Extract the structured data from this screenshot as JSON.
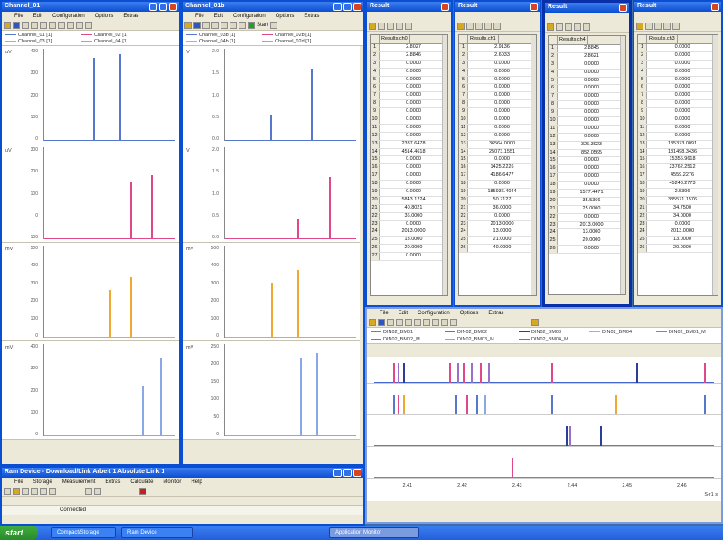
{
  "left_window": {
    "title": "Channel_01",
    "menus": [
      "File",
      "Edit",
      "Configuration",
      "Options",
      "Extras"
    ],
    "legend": [
      "Channel_01 [1]",
      "Channel_02 [1]",
      "Channel_03 [1]",
      "Channel_04 [1]"
    ],
    "plots": [
      {
        "unit": "uV",
        "color": "#5577cc",
        "yticks": [
          "400",
          "300",
          "200",
          "100",
          "0"
        ],
        "peaks": [
          {
            "x": 0.38,
            "h": 0.9
          },
          {
            "x": 0.58,
            "h": 0.94
          }
        ]
      },
      {
        "unit": "uV",
        "color": "#e0488a",
        "yticks": [
          "300",
          "200",
          "100",
          "0",
          "-100"
        ],
        "peaks": [
          {
            "x": 0.66,
            "h": 0.62
          },
          {
            "x": 0.82,
            "h": 0.7
          }
        ]
      },
      {
        "unit": "mV",
        "color": "#f0a830",
        "yticks": [
          "500",
          "400",
          "300",
          "200",
          "100",
          "0"
        ],
        "peaks": [
          {
            "x": 0.5,
            "h": 0.52
          },
          {
            "x": 0.66,
            "h": 0.66
          }
        ]
      },
      {
        "unit": "mV",
        "color": "#8aa8e8",
        "yticks": [
          "400",
          "300",
          "200",
          "100",
          "0"
        ],
        "peaks": [
          {
            "x": 0.75,
            "h": 0.55
          },
          {
            "x": 0.89,
            "h": 0.85
          }
        ]
      }
    ]
  },
  "mid_window": {
    "title": "Channel_01b",
    "menus": [
      "File",
      "Edit",
      "Configuration",
      "Options",
      "Extras"
    ],
    "legend": [
      "Channel_03b [1]",
      "Channel_02b [1]",
      "Channel_04b [1]",
      "Channel_02d [1]"
    ],
    "toolbar_label": "Start",
    "plots": [
      {
        "unit": "V",
        "color": "#5577cc",
        "yticks": [
          "2.0",
          "1.5",
          "1.0",
          "0.5",
          "0.0"
        ],
        "peaks": [
          {
            "x": 0.35,
            "h": 0.28
          },
          {
            "x": 0.66,
            "h": 0.78
          }
        ]
      },
      {
        "unit": "V",
        "color": "#e0488a",
        "yticks": [
          "2.0",
          "1.5",
          "1.0",
          "0.5",
          "0.0"
        ],
        "peaks": [
          {
            "x": 0.56,
            "h": 0.22
          },
          {
            "x": 0.8,
            "h": 0.68
          }
        ]
      },
      {
        "unit": "mV",
        "color": "#f0a830",
        "yticks": [
          "500",
          "400",
          "300",
          "200",
          "100",
          "0"
        ],
        "peaks": [
          {
            "x": 0.36,
            "h": 0.6
          },
          {
            "x": 0.56,
            "h": 0.74
          }
        ]
      },
      {
        "unit": "mV",
        "color": "#8aa8e8",
        "yticks": [
          "250",
          "200",
          "150",
          "100",
          "50",
          "0"
        ],
        "peaks": [
          {
            "x": 0.58,
            "h": 0.84
          },
          {
            "x": 0.7,
            "h": 0.9
          }
        ]
      }
    ]
  },
  "grids": [
    {
      "title": "Result",
      "header": "Results.ch0",
      "rows": [
        "2.8027",
        "2.8846",
        "0.0000",
        "0.0000",
        "0.0000",
        "0.0000",
        "0.0000",
        "0.0000",
        "0.0000",
        "0.0000",
        "0.0000",
        "0.0000",
        "2337.6478",
        "4514.4618",
        "0.0000",
        "0.0000",
        "0.0000",
        "0.0000",
        "0.0000",
        "5843.1224",
        "40.8021",
        "36.0000",
        "0.0000",
        "2013.0000",
        "13.0000",
        "20.0000",
        "0.0000"
      ]
    },
    {
      "title": "Result",
      "header": "Results.ch1",
      "rows": [
        "2.9136",
        "2.6033",
        "0.0000",
        "0.0000",
        "0.0000",
        "0.0000",
        "0.0000",
        "0.0000",
        "0.0000",
        "0.0000",
        "0.0000",
        "0.0000",
        "36564.0000",
        "25073.1551",
        "0.0000",
        "1425.2226",
        "4186.6477",
        "0.0000",
        "185936.4044",
        "50.7127",
        "36.0000",
        "0.0000",
        "2013.0000",
        "13.0000",
        "21.0000",
        "40.0000"
      ]
    },
    {
      "title": "Result",
      "header": "Results.ch4",
      "rows": [
        "2.8845",
        "2.8621",
        "0.0000",
        "0.0000",
        "0.0000",
        "0.0000",
        "0.0000",
        "0.0000",
        "0.0000",
        "0.0000",
        "0.0000",
        "0.0000",
        "325.3923",
        "852.0565",
        "0.0000",
        "0.0000",
        "0.0000",
        "0.0000",
        "1577.4471",
        "35.5366",
        "25.0000",
        "0.0000",
        "2013.0000",
        "13.0000",
        "20.0000",
        "0.0000"
      ]
    },
    {
      "title": "Result",
      "header": "Results.ch3",
      "rows": [
        "0.0000",
        "0.0000",
        "0.0000",
        "0.0000",
        "0.0000",
        "0.0000",
        "0.0000",
        "0.0000",
        "0.0000",
        "0.0000",
        "0.0000",
        "0.0000",
        "135373.0091",
        "181498.3436",
        "15356.9618",
        "23762.2512",
        "4559.2276",
        "45243.2773",
        "2.5396",
        "385571.1576",
        "34.7500",
        "34.0000",
        "0.0000",
        "2013.0000",
        "13.0000",
        "20.0000"
      ]
    }
  ],
  "bottom_window": {
    "menus": [
      "File",
      "Edit",
      "Configuration",
      "Options",
      "Extras"
    ],
    "legend": [
      "DIN02_BM01",
      "DIN02_BM02",
      "DIN02_BM03",
      "DIN02_BM04",
      "DIN02_BM01_M",
      "DIN02_BM02_M",
      "DIN02_BM03_M",
      "DIN02_BM04_M"
    ],
    "xticks": [
      "2.41",
      "2.42",
      "2.43",
      "2.44",
      "2.45",
      "2.46"
    ],
    "x_unit": "S-r1 s",
    "tracks": [
      {
        "base": "#4466cc",
        "marks": [
          {
            "x": 0.055,
            "c": "#e0488a"
          },
          {
            "x": 0.07,
            "c": "#9a70c8"
          },
          {
            "x": 0.085,
            "c": "#2a3f9c"
          },
          {
            "x": 0.22,
            "c": "#e0488a"
          },
          {
            "x": 0.245,
            "c": "#9a70c8"
          },
          {
            "x": 0.26,
            "c": "#e0488a"
          },
          {
            "x": 0.285,
            "c": "#9a70c8"
          },
          {
            "x": 0.31,
            "c": "#e0488a"
          },
          {
            "x": 0.335,
            "c": "#9a70c8"
          },
          {
            "x": 0.52,
            "c": "#e0488a"
          },
          {
            "x": 0.77,
            "c": "#2a3f9c"
          },
          {
            "x": 0.97,
            "c": "#e0488a"
          }
        ]
      },
      {
        "base": "#f0a830",
        "marks": [
          {
            "x": 0.055,
            "c": "#5577cc"
          },
          {
            "x": 0.07,
            "c": "#e0488a"
          },
          {
            "x": 0.085,
            "c": "#f0a830"
          },
          {
            "x": 0.24,
            "c": "#5577cc"
          },
          {
            "x": 0.27,
            "c": "#e0488a"
          },
          {
            "x": 0.3,
            "c": "#5577cc"
          },
          {
            "x": 0.325,
            "c": "#8aa8e8"
          },
          {
            "x": 0.52,
            "c": "#5577cc"
          },
          {
            "x": 0.71,
            "c": "#f0a830"
          },
          {
            "x": 0.97,
            "c": "#5577cc"
          }
        ]
      },
      {
        "base": "#e0488a",
        "marks": [
          {
            "x": 0.565,
            "c": "#2a3f9c"
          },
          {
            "x": 0.575,
            "c": "#9a70c8"
          },
          {
            "x": 0.665,
            "c": "#2a3f9c"
          }
        ]
      },
      {
        "base": "#9a70c8",
        "marks": [
          {
            "x": 0.405,
            "c": "#e0488a"
          }
        ]
      }
    ]
  },
  "taskbar": {
    "start": "start",
    "tasks": [
      "Compact/Storage",
      "Ram Device"
    ],
    "tray_window": "Application Monitor"
  },
  "dock_window": {
    "title": "Ram Device - Download/Link Arbeit 1 Absolute Link 1",
    "menus": [
      "File",
      "Storage",
      "Measurement",
      "Extras",
      "Calculate",
      "Monitor",
      "Help"
    ],
    "status": "Connected"
  }
}
